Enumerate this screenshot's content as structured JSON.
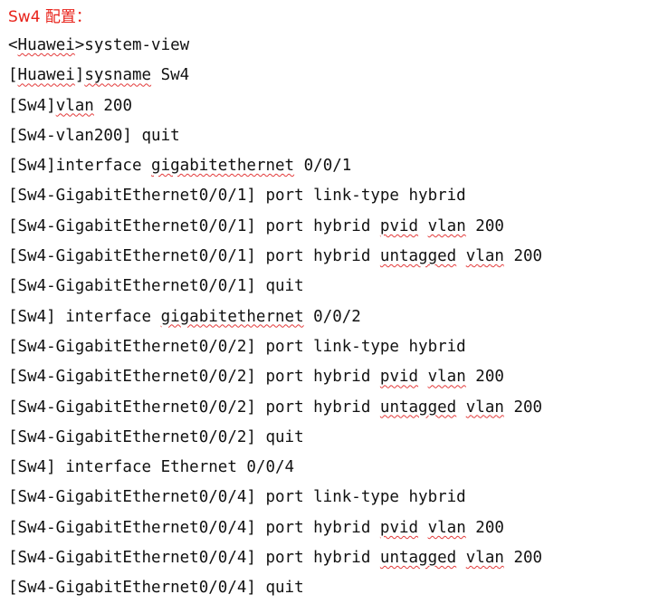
{
  "heading": "Sw4 配置：",
  "lines": [
    [
      {
        "t": "<"
      },
      {
        "t": "Huawei",
        "sq": true
      },
      {
        "t": ">system-view"
      }
    ],
    [
      {
        "t": "["
      },
      {
        "t": "Huawei",
        "sq": true
      },
      {
        "t": "]"
      },
      {
        "t": "sysname",
        "sq": true
      },
      {
        "t": " Sw4"
      }
    ],
    [
      {
        "t": "[Sw4]"
      },
      {
        "t": "vlan",
        "sq": true
      },
      {
        "t": " 200"
      }
    ],
    [
      {
        "t": "[Sw4-vlan200] quit"
      }
    ],
    [
      {
        "t": "[Sw4]interface "
      },
      {
        "t": "gigabitethernet",
        "sq": true
      },
      {
        "t": " 0/0/1"
      }
    ],
    [
      {
        "t": "[Sw4-GigabitEthernet0/0/1] port link-type hybrid"
      }
    ],
    [
      {
        "t": "[Sw4-GigabitEthernet0/0/1] port hybrid "
      },
      {
        "t": "pvid",
        "sq": true
      },
      {
        "t": " "
      },
      {
        "t": "vlan",
        "sq": true
      },
      {
        "t": " 200"
      }
    ],
    [
      {
        "t": "[Sw4-GigabitEthernet0/0/1] port hybrid "
      },
      {
        "t": "untagged",
        "sq": true
      },
      {
        "t": " "
      },
      {
        "t": "vlan",
        "sq": true
      },
      {
        "t": " 200"
      }
    ],
    [
      {
        "t": "[Sw4-GigabitEthernet0/0/1] quit"
      }
    ],
    [
      {
        "t": "[Sw4] interface "
      },
      {
        "t": "gigabitethernet",
        "sq": true
      },
      {
        "t": " 0/0/2"
      }
    ],
    [
      {
        "t": "[Sw4-GigabitEthernet0/0/2] port link-type hybrid"
      }
    ],
    [
      {
        "t": "[Sw4-GigabitEthernet0/0/2] port hybrid "
      },
      {
        "t": "pvid",
        "sq": true
      },
      {
        "t": " "
      },
      {
        "t": "vlan",
        "sq": true
      },
      {
        "t": " 200"
      }
    ],
    [
      {
        "t": "[Sw4-GigabitEthernet0/0/2] port hybrid "
      },
      {
        "t": "untagged",
        "sq": true
      },
      {
        "t": " "
      },
      {
        "t": "vlan",
        "sq": true
      },
      {
        "t": " 200"
      }
    ],
    [
      {
        "t": "[Sw4-GigabitEthernet0/0/2] quit"
      }
    ],
    [
      {
        "t": "[Sw4] interface Ethernet 0/0/4"
      }
    ],
    [
      {
        "t": "[Sw4-GigabitEthernet0/0/4] port link-type hybrid"
      }
    ],
    [
      {
        "t": "[Sw4-GigabitEthernet0/0/4] port hybrid "
      },
      {
        "t": "pvid",
        "sq": true
      },
      {
        "t": " "
      },
      {
        "t": "vlan",
        "sq": true
      },
      {
        "t": " 200"
      }
    ],
    [
      {
        "t": "[Sw4-GigabitEthernet0/0/4] port hybrid "
      },
      {
        "t": "untagged",
        "sq": true
      },
      {
        "t": " "
      },
      {
        "t": "vlan",
        "sq": true
      },
      {
        "t": " 200"
      }
    ],
    [
      {
        "t": "[Sw4-GigabitEthernet0/0/4] quit"
      }
    ]
  ],
  "colors": {
    "heading": "#e8231b",
    "text": "#111111",
    "spellcheck_underline": "#e33b3b"
  }
}
